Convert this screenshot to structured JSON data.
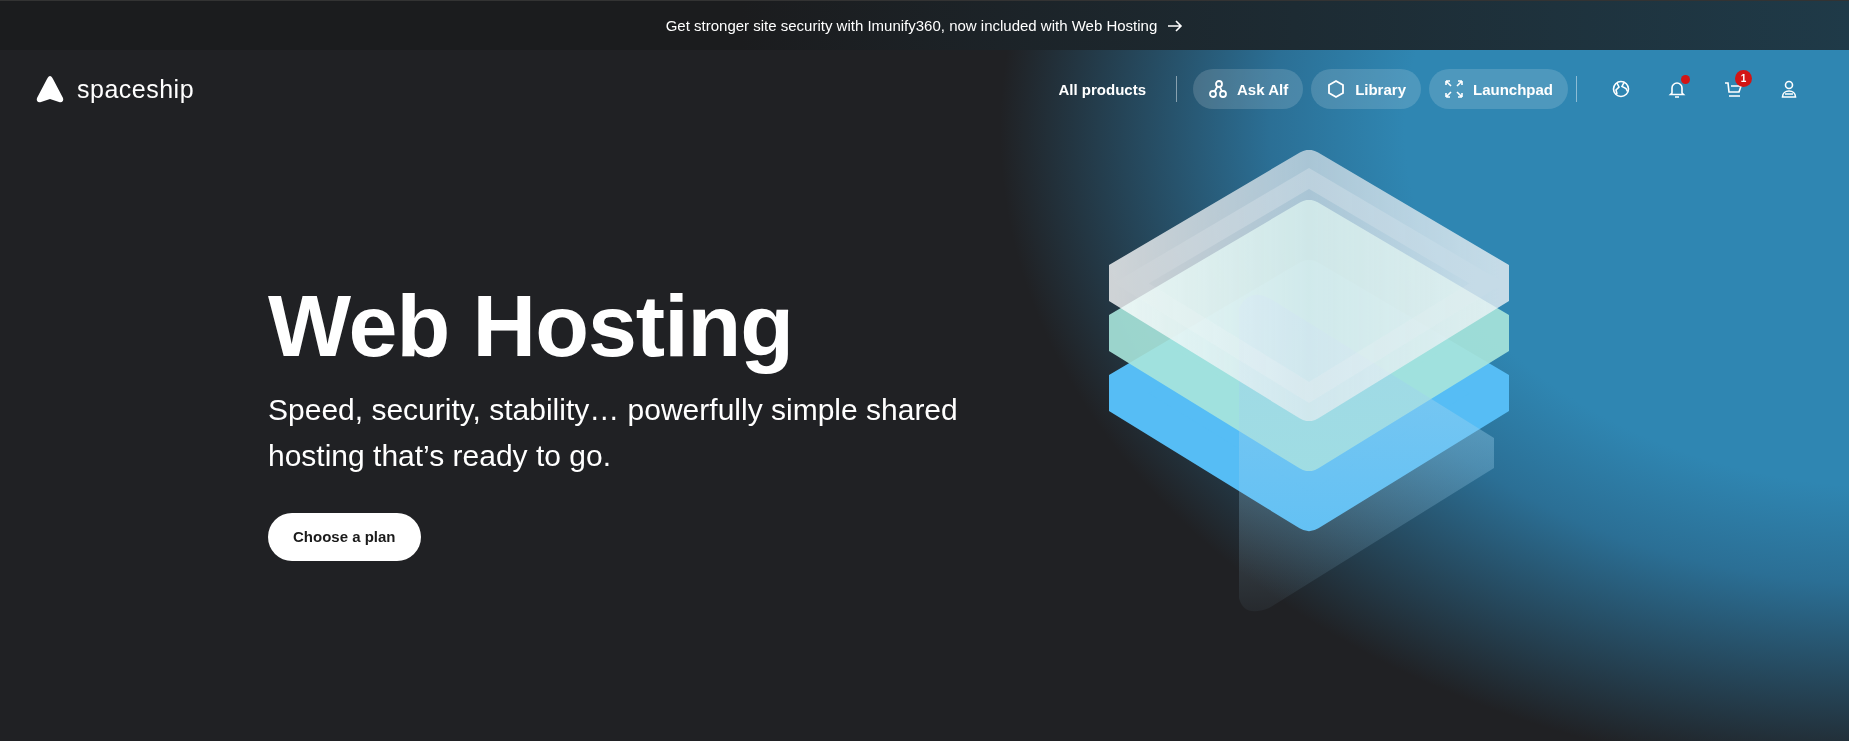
{
  "banner": {
    "text": "Get stronger site security with Imunify360, now included with Web Hosting"
  },
  "nav": {
    "logo": "spaceship",
    "link": "All products",
    "pills": [
      {
        "label": "Ask Alf",
        "kind": "alf"
      },
      {
        "label": "Library",
        "kind": "library"
      },
      {
        "label": "Launchpad",
        "kind": "launchpad"
      }
    ],
    "icons": [
      {
        "kind": "globe",
        "dot": false
      },
      {
        "kind": "bell",
        "dot": true
      },
      {
        "kind": "cart",
        "dot": false,
        "badge": "1"
      },
      {
        "kind": "user",
        "dot": false
      }
    ]
  },
  "hero": {
    "title": "Web Hosting",
    "subtitle": "Speed, security, stability… powerfully simple shared hosting that’s ready to go.",
    "button": "Choose a plan"
  }
}
